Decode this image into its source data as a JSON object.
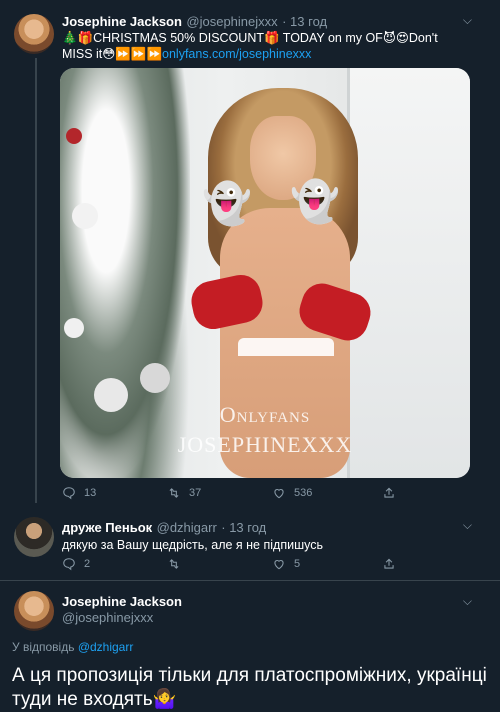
{
  "tweet1": {
    "name": "Josephine Jackson",
    "handle": "@josephinejxxx",
    "time": "· 13 год",
    "text_prefix": "🎄🎁CHRISTMAS 50% DISCOUNT🎁 TODAY on my OF😈😍Don't MISS it😳⏩⏩⏩",
    "link": "onlyfans.com/josephinexxx",
    "media": {
      "stickers": [
        "👻",
        "👻"
      ],
      "watermark_line1": "Onlyfans",
      "watermark_line2": "JOSEPHINEXXX"
    },
    "actions": {
      "replies": "13",
      "retweets": "37",
      "likes": "536"
    }
  },
  "tweet2": {
    "name": "друже Пеньок",
    "handle": "@dzhigarr",
    "time": "· 13 год",
    "text": "дякую за Вашу щедрість, але я не підпишусь",
    "actions": {
      "replies": "2",
      "retweets": "",
      "likes": "5"
    }
  },
  "tweet3": {
    "name": "Josephine Jackson",
    "handle": "@josephinejxxx",
    "reply_label": "У відповідь",
    "reply_handle": "@dzhigarr",
    "text": "А ця пропозиція тільки для платоспроміжних, українці туди не входять🤷‍♀️"
  },
  "colors": {
    "background": "#15202b",
    "link": "#1da1f2",
    "secondary": "#8899a6"
  }
}
